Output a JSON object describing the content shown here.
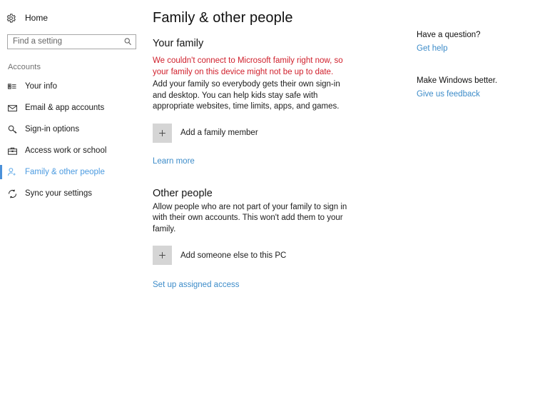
{
  "theme": {
    "accent": "#4a90d9",
    "link": "#3d8cc9",
    "warning": "#d0202c",
    "selected_text": "#4a9ae0",
    "plus_box_bg": "#d5d5d5",
    "page_bg": "#ffffff"
  },
  "sidebar": {
    "home": {
      "label": "Home",
      "icon": "gear-icon"
    },
    "search": {
      "placeholder": "Find a setting",
      "value": "",
      "icon": "search-icon"
    },
    "group_header": "Accounts",
    "items": [
      {
        "label": "Your info",
        "icon": "contact-card-icon",
        "selected": false
      },
      {
        "label": "Email & app accounts",
        "icon": "envelope-icon",
        "selected": false
      },
      {
        "label": "Sign-in options",
        "icon": "key-icon",
        "selected": false
      },
      {
        "label": "Access work or school",
        "icon": "briefcase-icon",
        "selected": false
      },
      {
        "label": "Family & other people",
        "icon": "person-add-icon",
        "selected": true
      },
      {
        "label": "Sync your settings",
        "icon": "sync-icon",
        "selected": false
      }
    ]
  },
  "main": {
    "page_title": "Family & other people",
    "your_family": {
      "section_title": "Your family",
      "warning": "We couldn't connect to Microsoft family right now, so your family on this device might not be up to date.",
      "description": "Add your family so everybody gets their own sign-in and desktop. You can help kids stay safe with appropriate websites, time limits, apps, and games.",
      "add_button": {
        "label": "Add a family member",
        "icon": "plus-icon"
      },
      "learn_more_link": "Learn more"
    },
    "other_people": {
      "section_title": "Other people",
      "description": "Allow people who are not part of your family to sign in with their own accounts. This won't add them to your family.",
      "add_button": {
        "label": "Add someone else to this PC",
        "icon": "plus-icon"
      },
      "assigned_access_link": "Set up assigned access"
    }
  },
  "rail": {
    "blocks": [
      {
        "heading": "Have a question?",
        "link": "Get help"
      },
      {
        "heading": "Make Windows better.",
        "link": "Give us feedback"
      }
    ]
  }
}
